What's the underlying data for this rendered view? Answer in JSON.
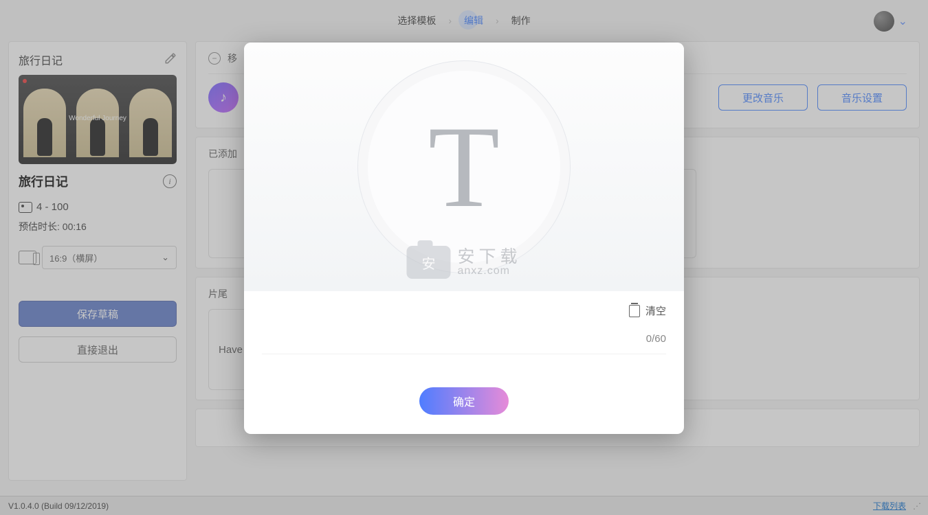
{
  "steps": {
    "s1": "选择模板",
    "s2": "编辑",
    "s3": "制作"
  },
  "sidebar": {
    "project_tag": "旅行日记",
    "thumb_caption": "Wonderful Journey",
    "project_name": "旅行日记",
    "image_count": "4 - 100",
    "duration_label": "预估时长: 00:16",
    "aspect_label": "16:9（横屏）",
    "save_draft": "保存草稿",
    "exit": "直接退出"
  },
  "content": {
    "move_label": "移",
    "added_label": "已添加",
    "change_music": "更改音乐",
    "music_settings": "音乐设置",
    "ending_label": "片尾",
    "ending_text": "Have"
  },
  "modal": {
    "clear_label": "清空",
    "counter": "0/60",
    "confirm": "确定",
    "input_value": ""
  },
  "watermark": {
    "cn": "安下载",
    "en": "anxz.com"
  },
  "footer": {
    "version": "V1.0.4.0 (Build 09/12/2019)",
    "download_list": "下载列表"
  }
}
